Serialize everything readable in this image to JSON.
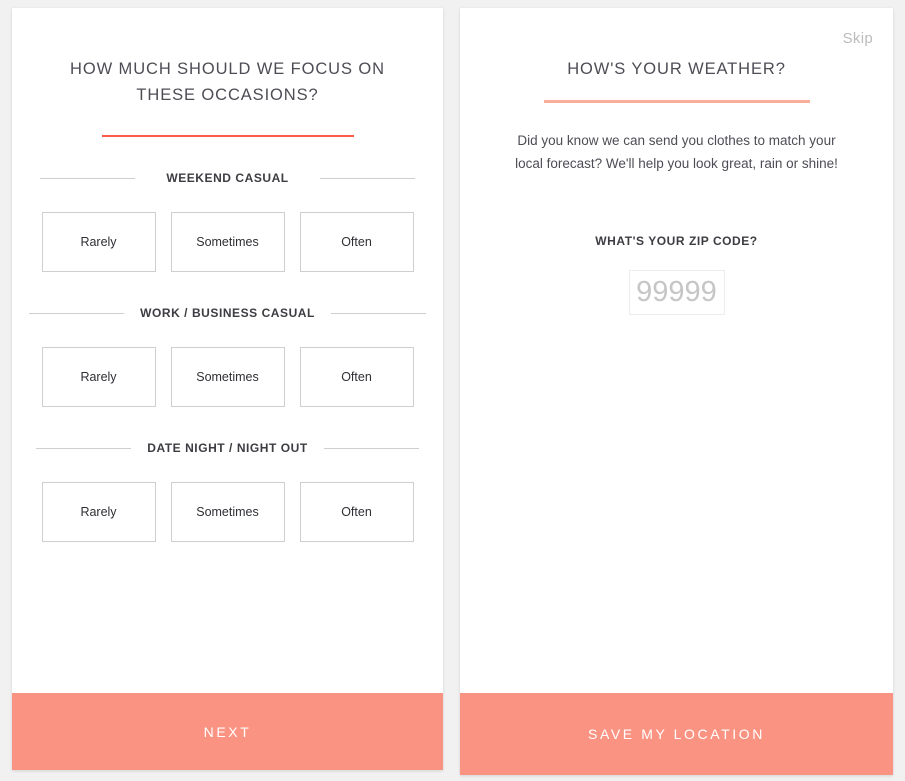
{
  "left_screen": {
    "title": "HOW MUCH SHOULD WE FOCUS ON THESE OCCASIONS?",
    "accent_color": "#f95a4a",
    "groups": [
      {
        "label": "WEEKEND CASUAL",
        "options": [
          "Rarely",
          "Sometimes",
          "Often"
        ]
      },
      {
        "label": "WORK / BUSINESS CASUAL",
        "options": [
          "Rarely",
          "Sometimes",
          "Often"
        ]
      },
      {
        "label": "DATE NIGHT / NIGHT OUT",
        "options": [
          "Rarely",
          "Sometimes",
          "Often"
        ]
      }
    ],
    "cta_label": "Next"
  },
  "right_screen": {
    "skip_label": "Skip",
    "title": "HOW'S YOUR WEATHER?",
    "accent_color": "#f9ae9d",
    "intro": "Did you know we can send you clothes to match your local forecast? We'll help you look great, rain or shine!",
    "zip_label": "WHAT'S YOUR ZIP CODE?",
    "zip_value": "",
    "zip_placeholder": "99999",
    "cta_label": "Save My Location"
  },
  "theme": {
    "cta_color": "#fb9382",
    "page_background": "#f1f1f1",
    "card_background": "#ffffff"
  }
}
